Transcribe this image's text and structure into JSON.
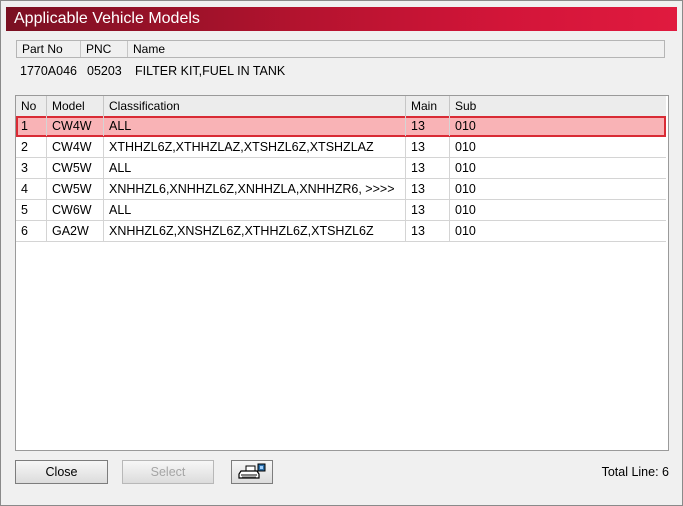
{
  "window": {
    "title": "Applicable Vehicle Models"
  },
  "part": {
    "headers": {
      "part_no": "Part No",
      "pnc": "PNC",
      "name": "Name"
    },
    "values": {
      "part_no": "1770A046",
      "pnc": "05203",
      "name": "FILTER KIT,FUEL IN TANK"
    }
  },
  "grid": {
    "headers": {
      "no": "No",
      "model": "Model",
      "classification": "Classification",
      "main": "Main",
      "sub": "Sub"
    },
    "rows": [
      {
        "no": "1",
        "model": "CW4W",
        "classification": "ALL",
        "main": "13",
        "sub": "010"
      },
      {
        "no": "2",
        "model": "CW4W",
        "classification": "XTHHZL6Z,XTHHZLAZ,XTSHZL6Z,XTSHZLAZ",
        "main": "13",
        "sub": "010"
      },
      {
        "no": "3",
        "model": "CW5W",
        "classification": "ALL",
        "main": "13",
        "sub": "010"
      },
      {
        "no": "4",
        "model": "CW5W",
        "classification": "XNHHZL6,XNHHZL6Z,XNHHZLA,XNHHZR6,  >>>>",
        "main": "13",
        "sub": "010"
      },
      {
        "no": "5",
        "model": "CW6W",
        "classification": "ALL",
        "main": "13",
        "sub": "010"
      },
      {
        "no": "6",
        "model": "GA2W",
        "classification": "XNHHZL6Z,XNSHZL6Z,XTHHZL6Z,XTSHZL6Z",
        "main": "13",
        "sub": "010"
      }
    ],
    "selected_row": 1
  },
  "buttons": {
    "close": "Close",
    "select": "Select",
    "print_icon": "printer-icon"
  },
  "footer": {
    "total_line": "Total Line: 6"
  },
  "colors": {
    "title_start": "#7a1022",
    "title_end": "#e01a3f",
    "selection_fill": "#f9b3b6",
    "selection_border": "#d92b35"
  }
}
